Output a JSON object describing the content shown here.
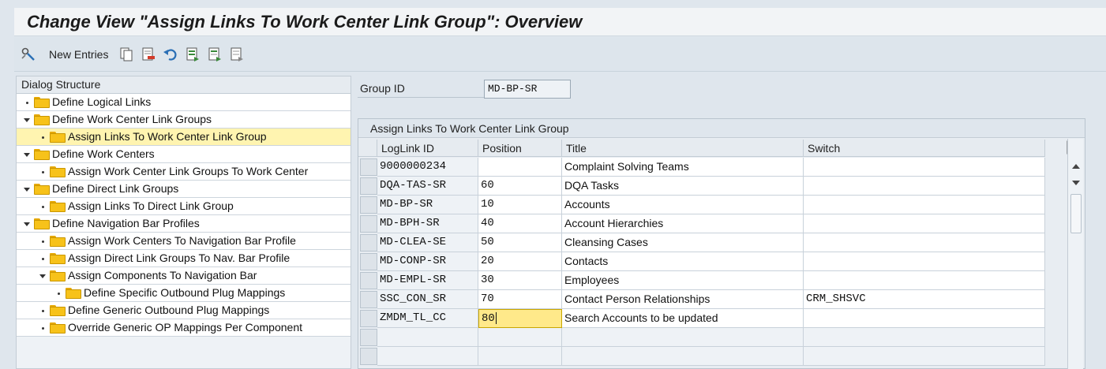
{
  "title": "Change View \"Assign Links To Work Center Link Group\": Overview",
  "toolbar": {
    "new_entries_label": "New Entries",
    "icons": [
      "display-change-icon",
      "copy-icon",
      "delete-icon",
      "undo-icon",
      "select-all-icon",
      "select-block-icon",
      "deselect-all-icon"
    ]
  },
  "dialog_structure": {
    "header": "Dialog Structure",
    "items": [
      {
        "label": "Define Logical Links",
        "level": 0,
        "marker": "dot",
        "selected": false,
        "open": false
      },
      {
        "label": "Define Work Center Link Groups",
        "level": 0,
        "marker": "expanded",
        "selected": false,
        "open": false
      },
      {
        "label": "Assign Links To Work Center Link Group",
        "level": 1,
        "marker": "dot",
        "selected": true,
        "open": true
      },
      {
        "label": "Define Work Centers",
        "level": 0,
        "marker": "expanded",
        "selected": false,
        "open": false
      },
      {
        "label": "Assign Work Center Link Groups To Work Center",
        "level": 1,
        "marker": "dot",
        "selected": false,
        "open": false
      },
      {
        "label": "Define Direct Link Groups",
        "level": 0,
        "marker": "expanded",
        "selected": false,
        "open": false
      },
      {
        "label": "Assign Links To Direct Link Group",
        "level": 1,
        "marker": "dot",
        "selected": false,
        "open": false
      },
      {
        "label": "Define Navigation Bar Profiles",
        "level": 0,
        "marker": "expanded",
        "selected": false,
        "open": false
      },
      {
        "label": "Assign Work Centers To Navigation Bar Profile",
        "level": 1,
        "marker": "dot",
        "selected": false,
        "open": false
      },
      {
        "label": "Assign Direct Link Groups To Nav. Bar Profile",
        "level": 1,
        "marker": "dot",
        "selected": false,
        "open": false
      },
      {
        "label": "Assign Components To Navigation Bar",
        "level": 1,
        "marker": "expanded",
        "selected": false,
        "open": false
      },
      {
        "label": "Define Specific Outbound Plug Mappings",
        "level": 2,
        "marker": "dot",
        "selected": false,
        "open": false
      },
      {
        "label": "Define Generic Outbound Plug Mappings",
        "level": 1,
        "marker": "dot",
        "selected": false,
        "open": false
      },
      {
        "label": "Override Generic OP Mappings Per Component",
        "level": 1,
        "marker": "dot",
        "selected": false,
        "open": false
      }
    ]
  },
  "group": {
    "label": "Group ID",
    "value": "MD-BP-SR"
  },
  "table": {
    "title": "Assign Links To Work Center Link Group",
    "columns": [
      "LogLink ID",
      "Position",
      "Title",
      "Switch"
    ],
    "rows": [
      {
        "loglink": "9000000234",
        "position": "",
        "title": "Complaint Solving Teams",
        "switch": ""
      },
      {
        "loglink": "DQA-TAS-SR",
        "position": "60",
        "title": "DQA Tasks",
        "switch": ""
      },
      {
        "loglink": "MD-BP-SR",
        "position": "10",
        "title": "Accounts",
        "switch": ""
      },
      {
        "loglink": "MD-BPH-SR",
        "position": "40",
        "title": "Account Hierarchies",
        "switch": ""
      },
      {
        "loglink": "MD-CLEA-SE",
        "position": "50",
        "title": "Cleansing Cases",
        "switch": ""
      },
      {
        "loglink": "MD-CONP-SR",
        "position": "20",
        "title": "Contacts",
        "switch": ""
      },
      {
        "loglink": "MD-EMPL-SR",
        "position": "30",
        "title": "Employees",
        "switch": ""
      },
      {
        "loglink": "SSC_CON_SR",
        "position": "70",
        "title": "Contact Person Relationships",
        "switch": "CRM_SHSVC"
      },
      {
        "loglink": "ZMDM_TL_CC",
        "position": "80",
        "title": "Search Accounts to be updated",
        "switch": ""
      }
    ],
    "empty_rows": 2
  },
  "colors": {
    "selected_row": "#fff4b0",
    "focus_cell": "#ffe98a",
    "folder": "#f7c21a"
  }
}
